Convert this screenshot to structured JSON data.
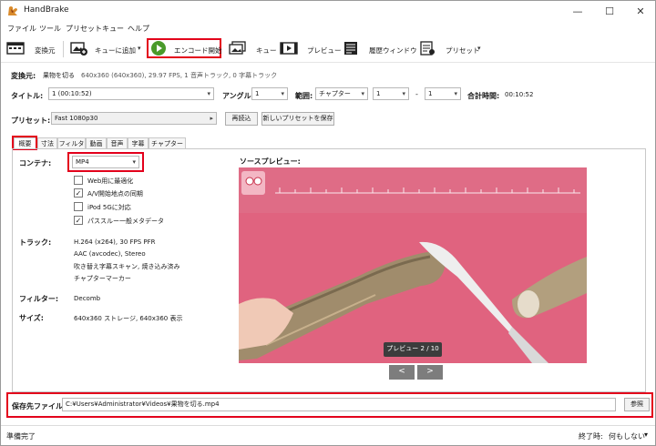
{
  "window": {
    "title": "HandBrake",
    "minimize_glyph": "—",
    "maximize_glyph": "☐",
    "close_glyph": "✕"
  },
  "menu": [
    "ファイル",
    "ツール",
    "プリセット",
    "キュー",
    "ヘルプ"
  ],
  "toolbar": {
    "convert_label": "変換元",
    "add_queue_label": "キューに追加",
    "start_label": "エンコード開始",
    "queue_label": "キュー",
    "preview_label": "プレビュー",
    "activity_label": "履歴ウィンドウ",
    "presets_label": "プリセット",
    "caret": "▾"
  },
  "source": {
    "label": "変換元:",
    "name": "果物を切る",
    "details": "640x360 (640x360), 29.97 FPS, 1 音声トラック, 0 字幕トラック"
  },
  "title_row": {
    "title_label": "タイトル:",
    "title_value": "1 (00:10:52)",
    "angle_label": "アングル:",
    "angle_value": "1",
    "range_label": "範囲:",
    "range_type": "チャプター",
    "range_start": "1",
    "range_dash": "-",
    "range_end": "1",
    "duration_label": "合計時間:",
    "duration_value": "00:10:52"
  },
  "preset_row": {
    "label": "プリセット:",
    "value": "Fast 1080p30",
    "arrow": "▸",
    "reload_button": "再読込",
    "save_new_button": "新しいプリセットを保存"
  },
  "tabs": [
    "概要",
    "寸法",
    "フィルタ",
    "動画",
    "音声",
    "字幕",
    "チャプター"
  ],
  "summary": {
    "container_label": "コンテナ:",
    "container_value": "MP4",
    "options": [
      {
        "label": "Web用に最適化",
        "checked": false
      },
      {
        "label": "A/V開始地点の同期",
        "checked": true
      },
      {
        "label": "iPod 5Gに対応",
        "checked": false
      },
      {
        "label": "パススルー一般メタデータ",
        "checked": true
      }
    ],
    "check_glyph": "✓",
    "tracks_label": "トラック:",
    "tracks": [
      "H.264 (x264), 30 FPS PFR",
      "AAC (avcodec), Stereo",
      "吹き替え字幕スキャン, 焼き込み済み",
      "チャプターマーカー"
    ],
    "filters_label": "フィルター:",
    "filters_value": "Decomb",
    "size_label": "サイズ:",
    "size_value": "640x360 ストレージ, 640x360 表示"
  },
  "preview": {
    "label": "ソースプレビュー:",
    "badge": "プレビュー 2 / 10",
    "prev_glyph": "<",
    "next_glyph": ">",
    "current": 2,
    "total": 10
  },
  "save": {
    "label": "保存先ファイル:",
    "path": "C:¥Users¥Administrator¥Videos¥果物を切る.mp4",
    "browse_button": "参照"
  },
  "status": {
    "text": "準備完了",
    "when_done_label": "終了時:",
    "when_done_value": "何もしない",
    "caret": "▾"
  },
  "colors": {
    "highlight": "#e3001b",
    "play_green": "#4a9a2a",
    "preview_bg": "#e0637f"
  }
}
